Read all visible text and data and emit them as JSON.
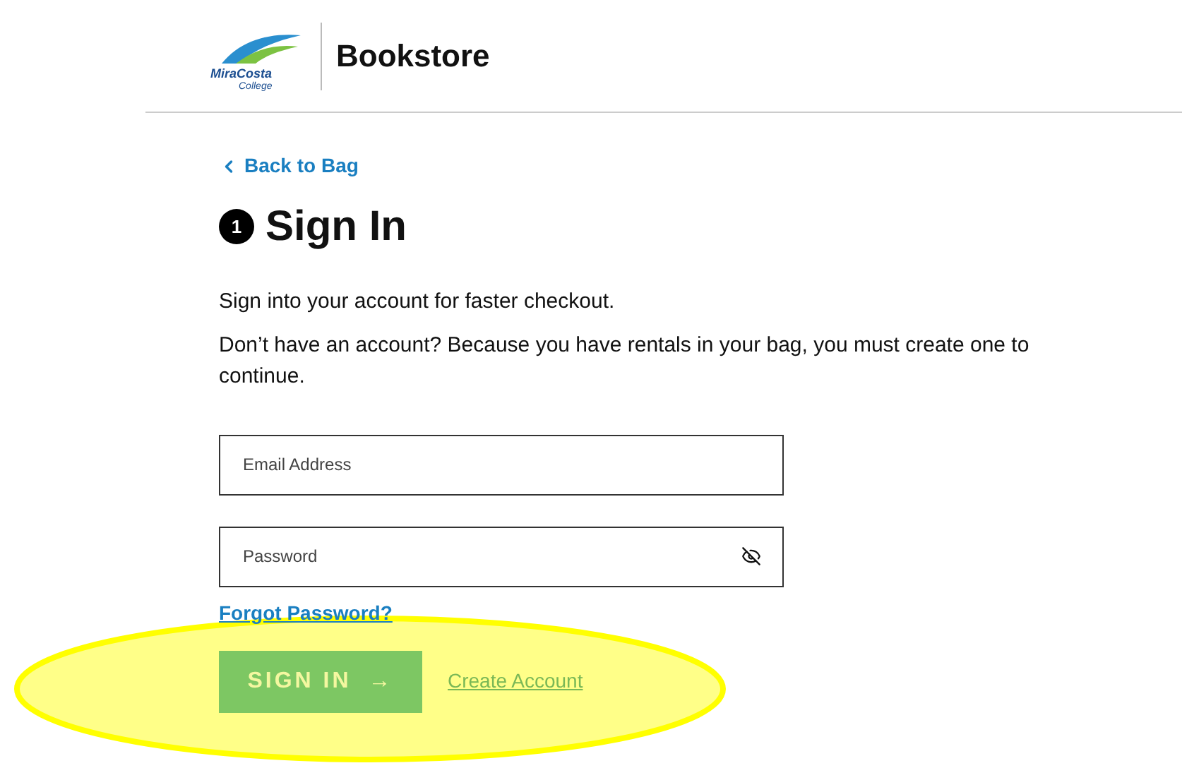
{
  "header": {
    "logo": {
      "line1": "MiraCosta",
      "line2": "College"
    },
    "title": "Bookstore"
  },
  "back_link": "Back to Bag",
  "step": {
    "number": "1",
    "title": "Sign In"
  },
  "intro": "Sign into your account for faster checkout.",
  "notice": "Don’t have an account? Because you have rentals in your bag, you must create one to continue.",
  "fields": [
    {
      "kind": "text",
      "placeholder": "Email Address"
    },
    {
      "kind": "password",
      "placeholder": "Password"
    }
  ],
  "forgot_link": "Forgot Password?",
  "sign_in_button": {
    "label": "SIGN IN",
    "arrow": "→"
  },
  "create_link": "Create Account",
  "highlight": true
}
